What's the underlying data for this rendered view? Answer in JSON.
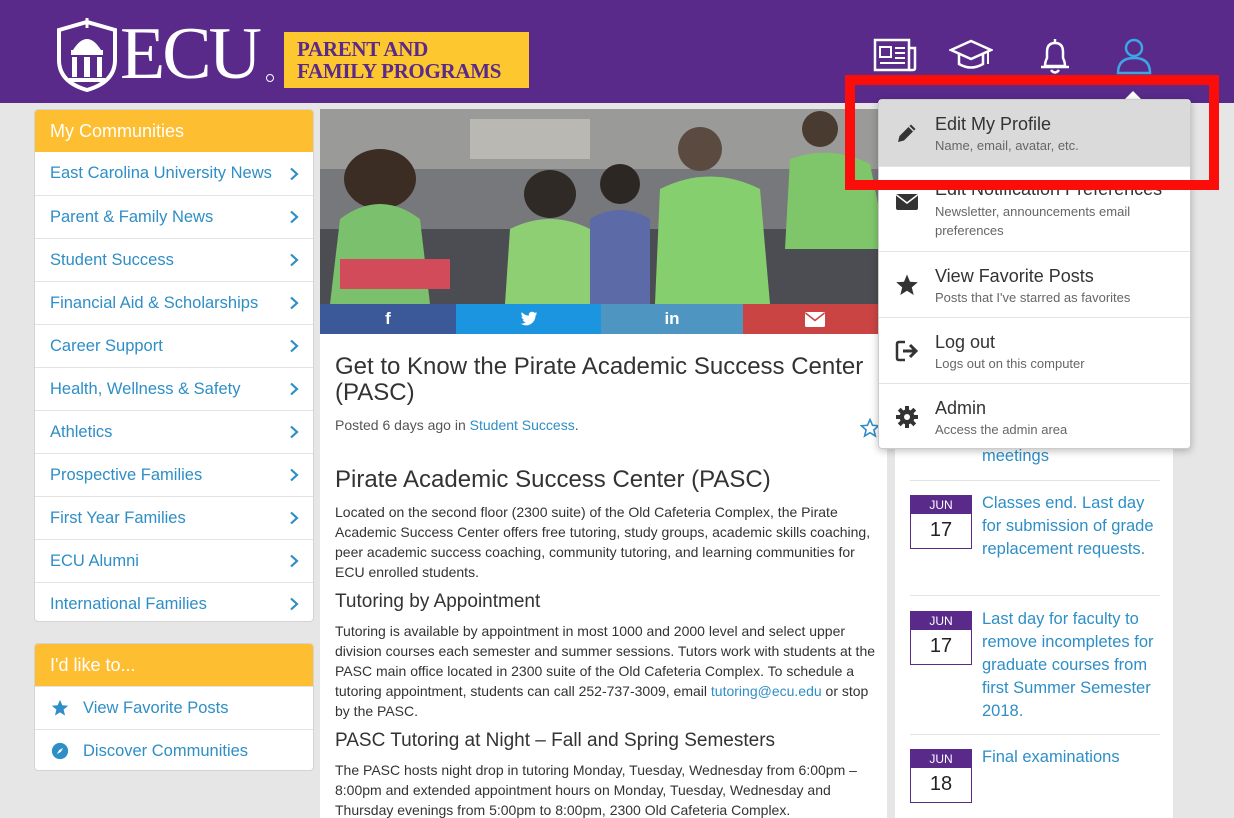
{
  "header": {
    "logo_text": "ECU",
    "program_line1": "PARENT AND",
    "program_line2": "FAMILY PROGRAMS",
    "icons": [
      "newspaper-icon",
      "graduation-cap-icon",
      "bell-icon",
      "user-icon"
    ]
  },
  "colors": {
    "header_purple": "#592a8a",
    "gold": "#fdbe32",
    "link_blue": "#2e8ec6",
    "facebook": "#3b5998",
    "twitter": "#1b95e0",
    "linkedin": "#4f95c2",
    "email": "#cb4444",
    "highlight_red": "#fb0d0a"
  },
  "sidebar": {
    "communities_title": "My Communities",
    "communities": [
      "East Carolina University News",
      "Parent & Family News",
      "Student Success",
      "Financial Aid & Scholarships",
      "Career Support",
      "Health, Wellness & Safety",
      "Athletics",
      "Prospective Families",
      "First Year Families",
      "ECU Alumni",
      "International Families"
    ],
    "like_title": "I'd like to...",
    "like_items": [
      {
        "label": "View Favorite Posts",
        "icon": "star-icon"
      },
      {
        "label": "Discover Communities",
        "icon": "compass-icon"
      }
    ]
  },
  "share": {
    "facebook": "f",
    "twitter_icon": "twitter-icon",
    "linkedin": "in",
    "email_icon": "envelope-icon"
  },
  "article": {
    "title": "Get to Know the Pirate Academic Success Center (PASC)",
    "meta_prefix": "Posted 6 days ago in ",
    "meta_link": "Student Success",
    "meta_suffix": ".",
    "heading": "Pirate Academic Success Center (PASC)",
    "p1": "Located on the second floor (2300 suite) of the Old Cafeteria Complex, the Pirate Academic Success Center offers free tutoring, study groups, academic skills coaching, peer academic success coaching, community tutoring, and learning communities for ECU enrolled students.",
    "h_tutoring": "Tutoring by Appointment",
    "p2_a": "Tutoring is available by appointment in most 1000 and 2000 level and select upper division courses each semester and summer sessions.  Tutors work with students at the PASC main office located in 2300 suite of the Old Cafeteria Complex.  To schedule a tutoring appointment, students can call 252-737-3009, email ",
    "p2_link": "tutoring@ecu.edu",
    "p2_b": " or stop by the PASC.",
    "h_night": "PASC Tutoring at Night – Fall and Spring Semesters",
    "p3": "The PASC hosts night drop in tutoring Monday, Tuesday, Wednesday from 6:00pm – 8:00pm and extended appointment hours on Monday, Tuesday, Wednesday and Thursday evenings from 5:00pm to 8:00pm, 2300 Old Cafeteria Complex."
  },
  "events": {
    "partial_title": "meetings",
    "items": [
      {
        "month": "JUN",
        "day": "17",
        "title": "Classes end. Last day for submission of grade replacement requests."
      },
      {
        "month": "JUN",
        "day": "17",
        "title": "Last day for faculty to remove incompletes for graduate courses from first Summer Semester 2018."
      },
      {
        "month": "JUN",
        "day": "18",
        "title": "Final examinations"
      }
    ]
  },
  "dropdown": {
    "items": [
      {
        "label": "Edit My Profile",
        "sub": "Name, email, avatar, etc.",
        "icon": "pencil-icon"
      },
      {
        "label": "Edit Notification Preferences",
        "sub": "Newsletter, announcements email preferences",
        "icon": "envelope-icon"
      },
      {
        "label": "View Favorite Posts",
        "sub": "Posts that I've starred as favorites",
        "icon": "star-icon"
      },
      {
        "label": "Log out",
        "sub": "Logs out on this computer",
        "icon": "sign-out-icon"
      },
      {
        "label": "Admin",
        "sub": "Access the admin area",
        "icon": "gear-icon"
      }
    ]
  }
}
